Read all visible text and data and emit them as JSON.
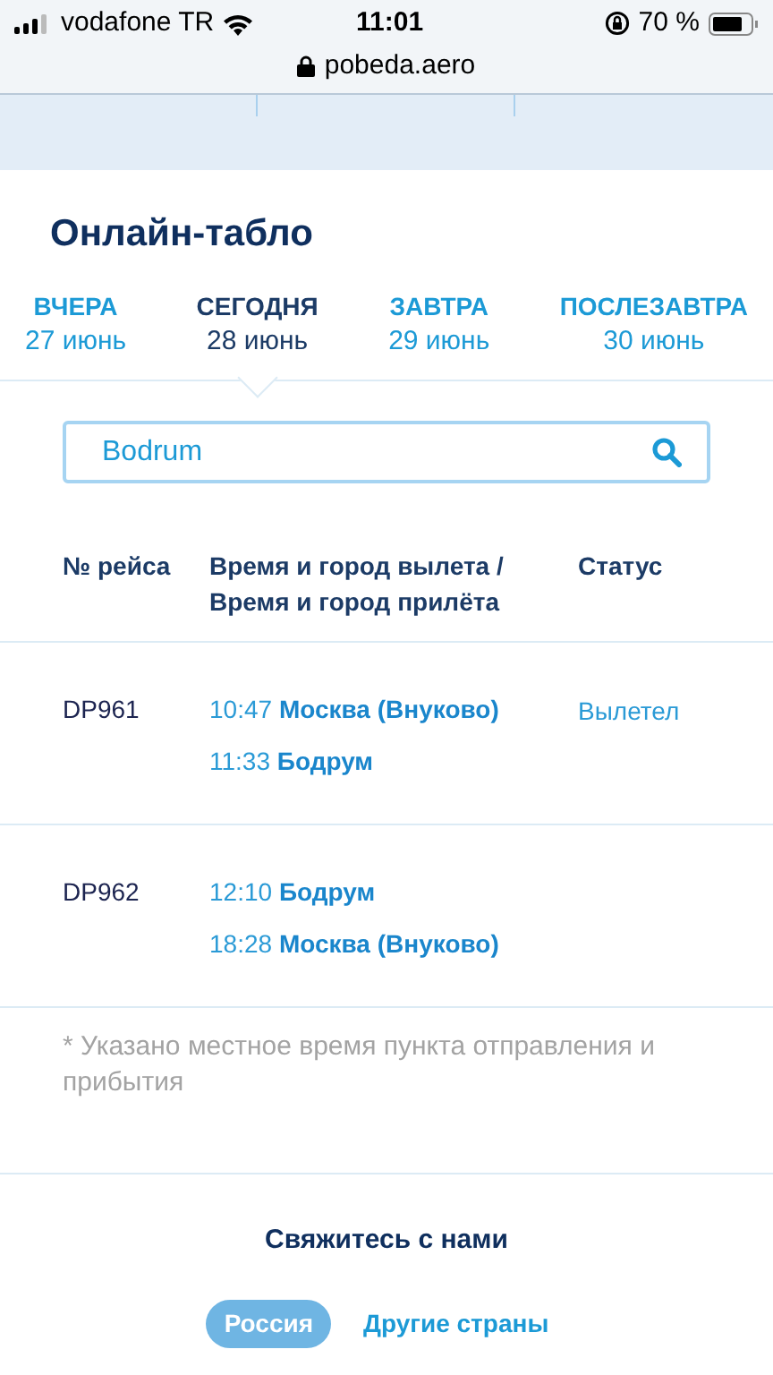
{
  "status_bar": {
    "carrier": "vodafone TR",
    "time": "11:01",
    "battery": "70 %"
  },
  "browser": {
    "url": "pobeda.aero"
  },
  "title": "Онлайн-табло",
  "tabs": [
    {
      "label": "ВЧЕРА",
      "date": "27 июнь",
      "selected": false
    },
    {
      "label": "СЕГОДНЯ",
      "date": "28 июнь",
      "selected": true
    },
    {
      "label": "ЗАВТРА",
      "date": "29 июнь",
      "selected": false
    },
    {
      "label": "ПОСЛЕЗАВТРА",
      "date": "30 июнь",
      "selected": false
    }
  ],
  "search": {
    "value": "Bodrum"
  },
  "table": {
    "columns": [
      "№ рейса",
      "Время и город вылета / Время и город прилёта",
      "Статус"
    ],
    "rows": [
      {
        "flight": "DP961",
        "legs": [
          {
            "time": "10:47",
            "city": "Москва (Внуково)"
          },
          {
            "time": "11:33",
            "city": "Бодрум"
          }
        ],
        "status": "Вылетел"
      },
      {
        "flight": "DP962",
        "legs": [
          {
            "time": "12:10",
            "city": "Бодрум"
          },
          {
            "time": "18:28",
            "city": "Москва (Внуково)"
          }
        ]
      }
    ]
  },
  "footnote": "* Указано местное время пункта отправления и прибытия",
  "contact": {
    "title": "Свяжитесь с нами",
    "regions": [
      {
        "label": "Россия",
        "selected": true
      },
      {
        "label": "Другие страны",
        "selected": false
      }
    ]
  }
}
